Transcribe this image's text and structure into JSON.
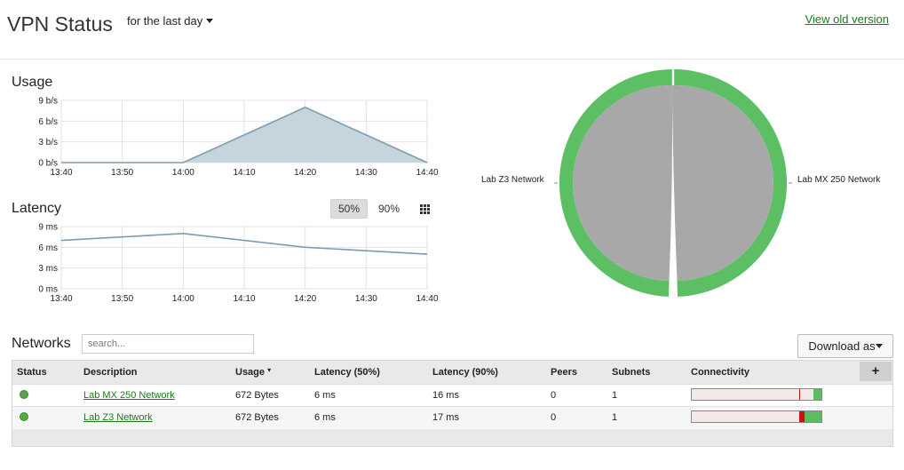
{
  "header": {
    "title": "VPN Status",
    "period": "for the last day",
    "old_version_link": "View old version"
  },
  "usage_chart": {
    "title": "Usage",
    "y_ticks": [
      "9 b/s",
      "6 b/s",
      "3 b/s",
      "0 b/s"
    ],
    "x_ticks": [
      "13:40",
      "13:50",
      "14:00",
      "14:10",
      "14:20",
      "14:30",
      "14:40"
    ]
  },
  "latency_chart": {
    "title": "Latency",
    "btn_50": "50%",
    "btn_90": "90%",
    "y_ticks": [
      "9 ms",
      "6 ms",
      "3 ms",
      "0 ms"
    ],
    "x_ticks": [
      "13:40",
      "13:50",
      "14:00",
      "14:10",
      "14:20",
      "14:30",
      "14:40"
    ]
  },
  "chord": {
    "left_label": "Lab Z3 Network",
    "right_label": "Lab MX 250 Network"
  },
  "chart_data": [
    {
      "type": "area",
      "title": "Usage",
      "x": [
        "13:40",
        "13:50",
        "14:00",
        "14:10",
        "14:20",
        "14:30",
        "14:40"
      ],
      "values": [
        0,
        0,
        0,
        4,
        8,
        4,
        0
      ],
      "ylim": [
        0,
        9
      ],
      "grid": true,
      "color": "#7f9caf"
    },
    {
      "type": "line",
      "title": "Latency",
      "x": [
        "13:40",
        "13:50",
        "14:00",
        "14:10",
        "14:20",
        "14:30",
        "14:40"
      ],
      "values": [
        7,
        7.5,
        8,
        7,
        6,
        5.5,
        5
      ],
      "ylim": [
        0,
        9
      ],
      "grid": true,
      "color": "#7f9caf"
    }
  ],
  "networks": {
    "title": "Networks",
    "search_placeholder": "search...",
    "download_label": "Download as",
    "plus_label": "+",
    "columns": [
      "Status",
      "Description",
      "Usage",
      "Latency (50%)",
      "Latency (90%)",
      "Peers",
      "Subnets",
      "Connectivity"
    ],
    "sort_indicator": "▾",
    "rows": [
      {
        "description": "Lab MX 250 Network",
        "usage": "672 Bytes",
        "lat50": "6 ms",
        "lat90": "16 ms",
        "peers": "0",
        "subnets": "1",
        "connectivity_green": 0.06,
        "connectivity_red_pos": 0.83
      },
      {
        "description": "Lab Z3 Network",
        "usage": "672 Bytes",
        "lat50": "6 ms",
        "lat90": "17 ms",
        "peers": "0",
        "subnets": "1",
        "connectivity_green": 0.13,
        "connectivity_red_pos": 0.83
      }
    ]
  },
  "colors": {
    "link": "#1a7a1a",
    "chord_green": "#5cbf64",
    "chord_gray": "#a8a8a8",
    "status_ok": "#55a845",
    "outage": "#cc1111"
  }
}
